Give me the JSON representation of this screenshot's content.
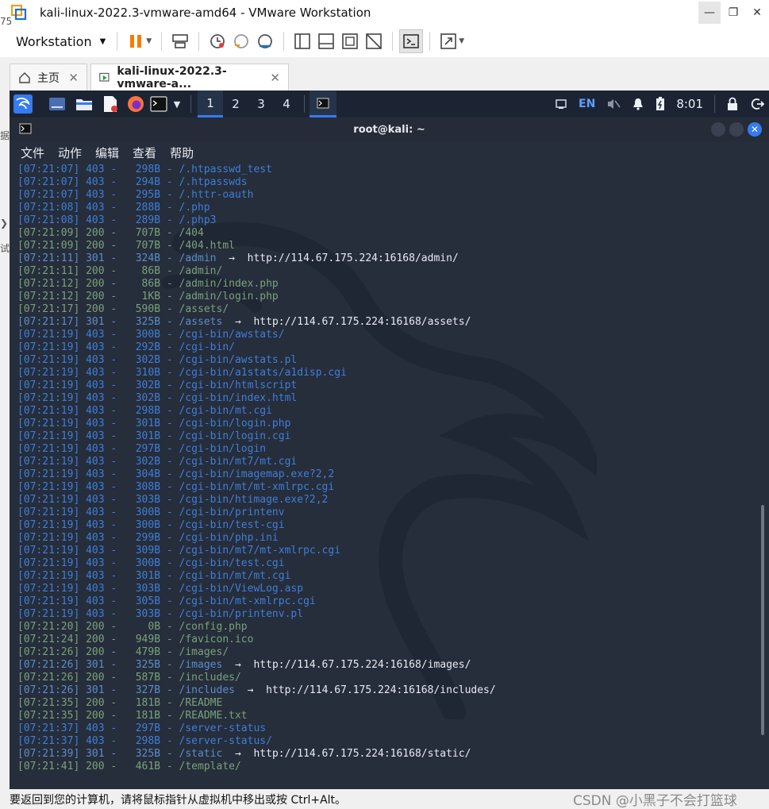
{
  "window": {
    "title": "kali-linux-2022.3-vmware-amd64 - VMware Workstation",
    "minimize_icon": "minimize-icon",
    "restore_icon": "restore-icon",
    "close_icon": "close-icon"
  },
  "toolbar": {
    "workstation_label": "Workstation"
  },
  "tabs": [
    {
      "label": "主页",
      "icon": "home-icon"
    },
    {
      "label": "kali-linux-2022.3-vmware-a...",
      "icon": "vm-running-icon"
    }
  ],
  "left_strip_glyphs": [
    "75",
    "据",
    "❯",
    "试"
  ],
  "panel": {
    "workspaces": [
      "1",
      "2",
      "3",
      "4"
    ],
    "lang": "EN",
    "clock": "8:01"
  },
  "terminal": {
    "title": "root@kali: ~",
    "menu": [
      "文件",
      "动作",
      "编辑",
      "查看",
      "帮助"
    ],
    "close_glyph": "✕",
    "lines": [
      {
        "time": "[07:21:07]",
        "code": "403",
        "size": "  298B",
        "path": "/.htpasswd_test",
        "redirect": ""
      },
      {
        "time": "[07:21:07]",
        "code": "403",
        "size": "  294B",
        "path": "/.htpasswds",
        "redirect": ""
      },
      {
        "time": "[07:21:07]",
        "code": "403",
        "size": "  295B",
        "path": "/.httr-oauth",
        "redirect": ""
      },
      {
        "time": "[07:21:08]",
        "code": "403",
        "size": "  288B",
        "path": "/.php",
        "redirect": ""
      },
      {
        "time": "[07:21:08]",
        "code": "403",
        "size": "  289B",
        "path": "/.php3",
        "redirect": ""
      },
      {
        "time": "[07:21:09]",
        "code": "200",
        "size": "  707B",
        "path": "/404",
        "redirect": ""
      },
      {
        "time": "[07:21:09]",
        "code": "200",
        "size": "  707B",
        "path": "/404.html",
        "redirect": ""
      },
      {
        "time": "[07:21:11]",
        "code": "301",
        "size": "  324B",
        "path": "/admin",
        "redirect": "http://114.67.175.224:16168/admin/"
      },
      {
        "time": "[07:21:11]",
        "code": "200",
        "size": "   86B",
        "path": "/admin/",
        "redirect": ""
      },
      {
        "time": "[07:21:12]",
        "code": "200",
        "size": "   86B",
        "path": "/admin/index.php",
        "redirect": ""
      },
      {
        "time": "[07:21:12]",
        "code": "200",
        "size": "   1KB",
        "path": "/admin/login.php",
        "redirect": ""
      },
      {
        "time": "[07:21:17]",
        "code": "200",
        "size": "  590B",
        "path": "/assets/",
        "redirect": ""
      },
      {
        "time": "[07:21:17]",
        "code": "301",
        "size": "  325B",
        "path": "/assets",
        "redirect": "http://114.67.175.224:16168/assets/"
      },
      {
        "time": "[07:21:19]",
        "code": "403",
        "size": "  300B",
        "path": "/cgi-bin/awstats/",
        "redirect": ""
      },
      {
        "time": "[07:21:19]",
        "code": "403",
        "size": "  292B",
        "path": "/cgi-bin/",
        "redirect": ""
      },
      {
        "time": "[07:21:19]",
        "code": "403",
        "size": "  302B",
        "path": "/cgi-bin/awstats.pl",
        "redirect": ""
      },
      {
        "time": "[07:21:19]",
        "code": "403",
        "size": "  310B",
        "path": "/cgi-bin/a1stats/a1disp.cgi",
        "redirect": ""
      },
      {
        "time": "[07:21:19]",
        "code": "403",
        "size": "  302B",
        "path": "/cgi-bin/htmlscript",
        "redirect": ""
      },
      {
        "time": "[07:21:19]",
        "code": "403",
        "size": "  302B",
        "path": "/cgi-bin/index.html",
        "redirect": ""
      },
      {
        "time": "[07:21:19]",
        "code": "403",
        "size": "  298B",
        "path": "/cgi-bin/mt.cgi",
        "redirect": ""
      },
      {
        "time": "[07:21:19]",
        "code": "403",
        "size": "  301B",
        "path": "/cgi-bin/login.php",
        "redirect": ""
      },
      {
        "time": "[07:21:19]",
        "code": "403",
        "size": "  301B",
        "path": "/cgi-bin/login.cgi",
        "redirect": ""
      },
      {
        "time": "[07:21:19]",
        "code": "403",
        "size": "  297B",
        "path": "/cgi-bin/login",
        "redirect": ""
      },
      {
        "time": "[07:21:19]",
        "code": "403",
        "size": "  302B",
        "path": "/cgi-bin/mt7/mt.cgi",
        "redirect": ""
      },
      {
        "time": "[07:21:19]",
        "code": "403",
        "size": "  304B",
        "path": "/cgi-bin/imagemap.exe?2,2",
        "redirect": ""
      },
      {
        "time": "[07:21:19]",
        "code": "403",
        "size": "  308B",
        "path": "/cgi-bin/mt/mt-xmlrpc.cgi",
        "redirect": ""
      },
      {
        "time": "[07:21:19]",
        "code": "403",
        "size": "  303B",
        "path": "/cgi-bin/htimage.exe?2,2",
        "redirect": ""
      },
      {
        "time": "[07:21:19]",
        "code": "403",
        "size": "  300B",
        "path": "/cgi-bin/printenv",
        "redirect": ""
      },
      {
        "time": "[07:21:19]",
        "code": "403",
        "size": "  300B",
        "path": "/cgi-bin/test-cgi",
        "redirect": ""
      },
      {
        "time": "[07:21:19]",
        "code": "403",
        "size": "  299B",
        "path": "/cgi-bin/php.ini",
        "redirect": ""
      },
      {
        "time": "[07:21:19]",
        "code": "403",
        "size": "  309B",
        "path": "/cgi-bin/mt7/mt-xmlrpc.cgi",
        "redirect": ""
      },
      {
        "time": "[07:21:19]",
        "code": "403",
        "size": "  300B",
        "path": "/cgi-bin/test.cgi",
        "redirect": ""
      },
      {
        "time": "[07:21:19]",
        "code": "403",
        "size": "  301B",
        "path": "/cgi-bin/mt/mt.cgi",
        "redirect": ""
      },
      {
        "time": "[07:21:19]",
        "code": "403",
        "size": "  303B",
        "path": "/cgi-bin/ViewLog.asp",
        "redirect": ""
      },
      {
        "time": "[07:21:19]",
        "code": "403",
        "size": "  305B",
        "path": "/cgi-bin/mt-xmlrpc.cgi",
        "redirect": ""
      },
      {
        "time": "[07:21:19]",
        "code": "403",
        "size": "  303B",
        "path": "/cgi-bin/printenv.pl",
        "redirect": ""
      },
      {
        "time": "[07:21:20]",
        "code": "200",
        "size": "    0B",
        "path": "/config.php",
        "redirect": ""
      },
      {
        "time": "[07:21:24]",
        "code": "200",
        "size": "  949B",
        "path": "/favicon.ico",
        "redirect": ""
      },
      {
        "time": "[07:21:26]",
        "code": "200",
        "size": "  479B",
        "path": "/images/",
        "redirect": ""
      },
      {
        "time": "[07:21:26]",
        "code": "301",
        "size": "  325B",
        "path": "/images",
        "redirect": "http://114.67.175.224:16168/images/"
      },
      {
        "time": "[07:21:26]",
        "code": "200",
        "size": "  587B",
        "path": "/includes/",
        "redirect": ""
      },
      {
        "time": "[07:21:26]",
        "code": "301",
        "size": "  327B",
        "path": "/includes",
        "redirect": "http://114.67.175.224:16168/includes/"
      },
      {
        "time": "[07:21:35]",
        "code": "200",
        "size": "  181B",
        "path": "/README",
        "redirect": ""
      },
      {
        "time": "[07:21:35]",
        "code": "200",
        "size": "  181B",
        "path": "/README.txt",
        "redirect": ""
      },
      {
        "time": "[07:21:37]",
        "code": "403",
        "size": "  297B",
        "path": "/server-status",
        "redirect": ""
      },
      {
        "time": "[07:21:37]",
        "code": "403",
        "size": "  298B",
        "path": "/server-status/",
        "redirect": ""
      },
      {
        "time": "[07:21:39]",
        "code": "301",
        "size": "  325B",
        "path": "/static",
        "redirect": "http://114.67.175.224:16168/static/"
      },
      {
        "time": "[07:21:41]",
        "code": "200",
        "size": "  461B",
        "path": "/template/",
        "redirect": ""
      }
    ]
  },
  "status_bar": {
    "text": "要返回到您的计算机，请将鼠标指针从虚拟机中移出或按 Ctrl+Alt。",
    "watermark": "CSDN @小黑子不会打篮球"
  },
  "colors": {
    "code_403": "#3f7fd8",
    "code_200": "#7aa27a",
    "code_301": "#5b8ec9",
    "accent": "#367bf0"
  }
}
